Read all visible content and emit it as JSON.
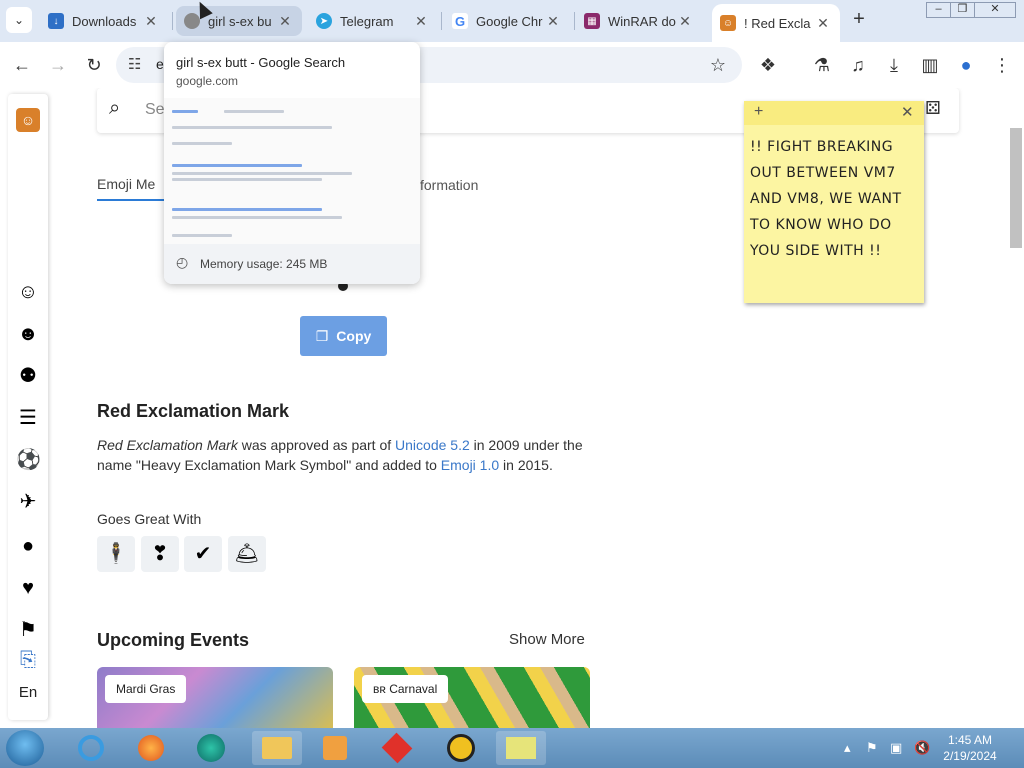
{
  "tabs": [
    {
      "title": "Downloads",
      "fav_color": "#2e6fc6"
    },
    {
      "title": "girl s-ex bu",
      "fav_color": "#888888"
    },
    {
      "title": "Telegram",
      "fav_color": "#2aa3de"
    },
    {
      "title": "Google Chr",
      "fav_color": "#4285f4"
    },
    {
      "title": "WinRAR do",
      "fav_color": "#8b2a6b"
    },
    {
      "title": "! Red Excla",
      "fav_color": "#d9802a"
    }
  ],
  "toolbar": {
    "url_text": "e"
  },
  "hover_card": {
    "title": "girl s-ex butt - Google Search",
    "url": "google.com",
    "memory": "Memory usage: 245 MB"
  },
  "page": {
    "search_placeholder": "Se",
    "tab_emoji_meaning": "Emoji Me",
    "tab_information": "formation",
    "copy_label": "Copy",
    "section_title": "Red Exclamation Mark",
    "para": {
      "name_em": "Red Exclamation Mark",
      "t1": " was approved as part of ",
      "link_unicode": "Unicode 5.2",
      "t2": " in 2009 under the name \"Heavy Exclamation Mark Symbol\" and added to ",
      "link_emoji": "Emoji 1.0",
      "t3": " in 2015."
    },
    "goes_great_with": "Goes Great With",
    "chips": [
      "🕴",
      "❣",
      "✔",
      "🛎"
    ],
    "upcoming_events": "Upcoming Events",
    "show_more": "Show More",
    "events": [
      {
        "label": "Mardi Gras"
      },
      {
        "label": "ʙʀ Carnaval"
      }
    ],
    "rail_lang": "En"
  },
  "sticky_note": {
    "text": "!! FIGHT BREAKING OUT BETWEEN VM7 AND VM8, WE WANT TO KNOW WHO DO YOU SIDE WITH !!"
  },
  "taskbar": {
    "time": "1:45 AM",
    "date": "2/19/2024"
  }
}
